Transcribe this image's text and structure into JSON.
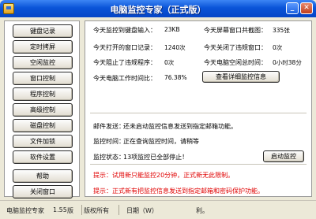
{
  "window": {
    "title": "电脑监控专家（正式版）"
  },
  "nav": {
    "items": [
      {
        "label": "键盘记录"
      },
      {
        "label": "定时拷屏"
      },
      {
        "label": "空闲监控"
      },
      {
        "label": "窗口控制"
      },
      {
        "label": "程序控制"
      },
      {
        "label": "高级控制"
      },
      {
        "label": "磁盘控制"
      },
      {
        "label": "文件加锁"
      },
      {
        "label": "软件设置"
      },
      {
        "label": "帮助"
      },
      {
        "label": "关闭窗口"
      }
    ]
  },
  "stats": {
    "keyboard_input_label": "今天监控到键盘输入：",
    "keyboard_input_value": "23KB",
    "screenshots_label": "今天屏幕窗口共截图：",
    "screenshots_value": "335张",
    "windows_opened_label": "今天打开的窗口记录：",
    "windows_opened_value": "1240次",
    "violations_closed_label": "今天关闭了违规窗口：",
    "violations_closed_value": "0次",
    "violations_blocked_label": "今天阻止了违规程序：",
    "violations_blocked_value": "0次",
    "idle_total_label": "今天电脑空闲总时间：",
    "idle_total_value": "0小时38分",
    "work_ratio_label": "今天电脑工作时间比：",
    "work_ratio_value": "76.38%",
    "detail_button": "查看详细监控信息"
  },
  "info": {
    "mail_label": "邮件发送：",
    "mail_text": "还未启动监控信息发送到指定邮箱功能。",
    "monitor_time_label": "监控时间：",
    "monitor_time_text": "正在查询监控时间，请稍等",
    "monitor_status_label": "监控状态：",
    "monitor_status_text": "13项监控已全部停止！",
    "start_button": "启动监控"
  },
  "tips": {
    "tip1_label": "提示：",
    "tip1_text": "试用新只能监控20分钟，正式新无此限制。",
    "tip2_label": "提示：",
    "tip2_text": "正式新有把监控信息发送到指定邮箱和密码保护功能。"
  },
  "status": {
    "app_name": "电脑监控专家",
    "version": "1.55",
    "version_label": "版",
    "copyright": "版权所有",
    "date": "日期（W）",
    "trailing": "利。"
  },
  "colors": {
    "tip": "#e00000",
    "titlebar": "#0a54d8"
  }
}
